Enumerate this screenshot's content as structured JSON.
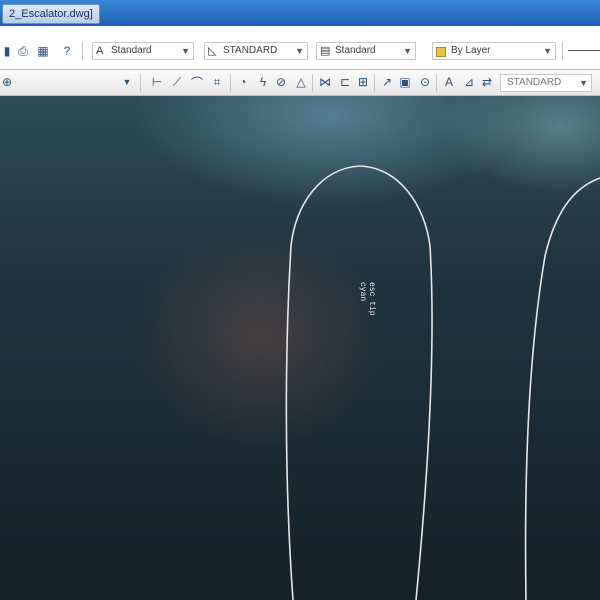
{
  "window": {
    "tab_title": "2_Escalator.dwg]"
  },
  "toolbar_top": {
    "text_style": "Standard",
    "dim_style": "STANDARD",
    "table_style": "Standard",
    "layer": "By Layer"
  },
  "toolbar_dim": {
    "dim_style": "STANDARD"
  },
  "drawing": {
    "label_line1": "esc tip",
    "label_line2": "cyan"
  },
  "colors": {
    "canvas_bg": "#1c2a33",
    "entity_line": "#e6e6e6",
    "title_bar": "#1f5fb4"
  }
}
